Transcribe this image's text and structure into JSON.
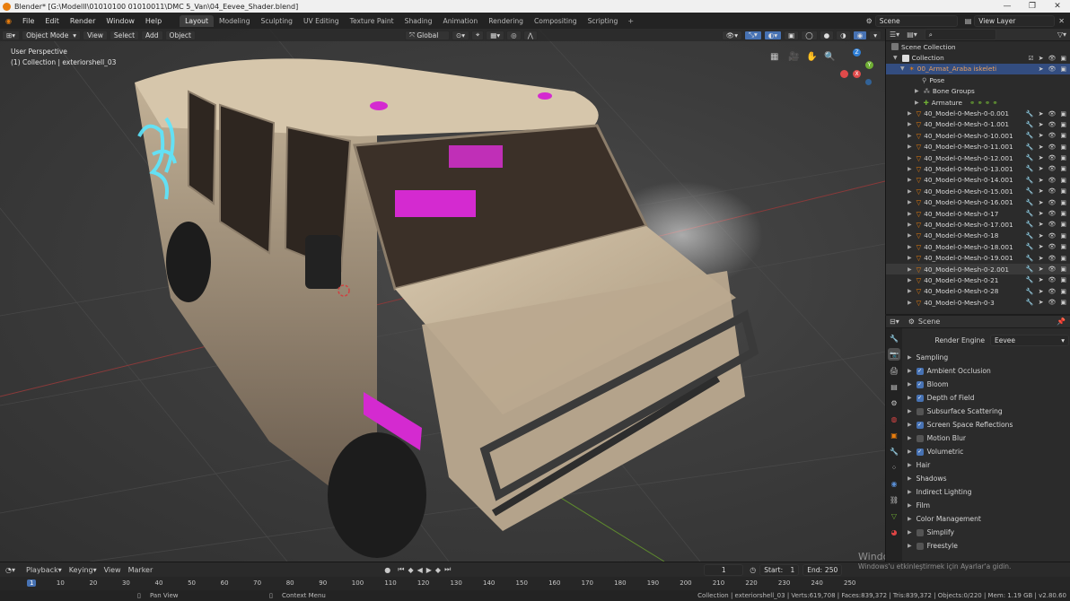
{
  "window": {
    "title": "Blender* [G:\\Modelll\\01010100 01010011\\DMC 5_Van\\04_Eevee_Shader.blend]"
  },
  "menu": [
    "File",
    "Edit",
    "Render",
    "Window",
    "Help"
  ],
  "workspaces": [
    "Layout",
    "Modeling",
    "Sculpting",
    "UV Editing",
    "Texture Paint",
    "Shading",
    "Animation",
    "Rendering",
    "Compositing",
    "Scripting"
  ],
  "active_workspace": "Layout",
  "scene": {
    "name": "Scene",
    "view_layer": "View Layer"
  },
  "viewport": {
    "mode": "Object Mode",
    "menus": [
      "View",
      "Select",
      "Add",
      "Object"
    ],
    "orientation": "Global",
    "perspective": "User Perspective",
    "collection_info": "(1) Collection | exteriorshell_03",
    "gizmo_axes": {
      "x": "X",
      "y": "Y",
      "z": "Z"
    }
  },
  "outliner": {
    "root": "Scene Collection",
    "collection": "Collection",
    "armature_obj": "00_Armat_Araba iskeleti",
    "children": [
      "Pose",
      "Bone Groups",
      "Armature"
    ],
    "meshes": [
      "40_Model-0-Mesh-0-0.001",
      "40_Model-0-Mesh-0-1.001",
      "40_Model-0-Mesh-0-10.001",
      "40_Model-0-Mesh-0-11.001",
      "40_Model-0-Mesh-0-12.001",
      "40_Model-0-Mesh-0-13.001",
      "40_Model-0-Mesh-0-14.001",
      "40_Model-0-Mesh-0-15.001",
      "40_Model-0-Mesh-0-16.001",
      "40_Model-0-Mesh-0-17",
      "40_Model-0-Mesh-0-17.001",
      "40_Model-0-Mesh-0-18",
      "40_Model-0-Mesh-0-18.001",
      "40_Model-0-Mesh-0-19.001",
      "40_Model-0-Mesh-0-2.001",
      "40_Model-0-Mesh-0-21",
      "40_Model-0-Mesh-0-28",
      "40_Model-0-Mesh-0-3"
    ]
  },
  "properties": {
    "context": "Scene",
    "render_engine_label": "Render Engine",
    "render_engine": "Eevee",
    "panels": [
      {
        "label": "Sampling",
        "check": null
      },
      {
        "label": "Ambient Occlusion",
        "check": true
      },
      {
        "label": "Bloom",
        "check": true
      },
      {
        "label": "Depth of Field",
        "check": true
      },
      {
        "label": "Subsurface Scattering",
        "check": false
      },
      {
        "label": "Screen Space Reflections",
        "check": true
      },
      {
        "label": "Motion Blur",
        "check": false
      },
      {
        "label": "Volumetric",
        "check": true
      },
      {
        "label": "Hair",
        "check": null
      },
      {
        "label": "Shadows",
        "check": null
      },
      {
        "label": "Indirect Lighting",
        "check": null
      },
      {
        "label": "Film",
        "check": null
      },
      {
        "label": "Color Management",
        "check": null
      },
      {
        "label": "Simplify",
        "check": false
      },
      {
        "label": "Freestyle",
        "check": false
      }
    ]
  },
  "timeline": {
    "menus": [
      "Playback",
      "Keying",
      "View",
      "Marker"
    ],
    "current_frame": "1",
    "start_label": "Start:",
    "start": "1",
    "end_label": "End:",
    "end": "250",
    "ticks": [
      "1",
      "10",
      "20",
      "30",
      "40",
      "50",
      "60",
      "70",
      "80",
      "90",
      "100",
      "110",
      "120",
      "130",
      "140",
      "150",
      "160",
      "170",
      "180",
      "190",
      "200",
      "210",
      "220",
      "230",
      "240",
      "250"
    ]
  },
  "status": {
    "pan": "Pan View",
    "context": "Context Menu",
    "stats": "Collection | exteriorshell_03 | Verts:619,708 | Faces:839,372 | Tris:839,372 | Objects:0/220 | Mem: 1.19 GB | v2.80.60"
  },
  "watermark": {
    "line1": "Windows'u Etkinleştir",
    "line2": "Windows'u etkinleştirmek için Ayarlar'a gidin."
  },
  "colors": {
    "accent": "#4772b3",
    "selected_row": "#334d80",
    "orange": "#e87d0d",
    "van": "#cbb89d"
  }
}
